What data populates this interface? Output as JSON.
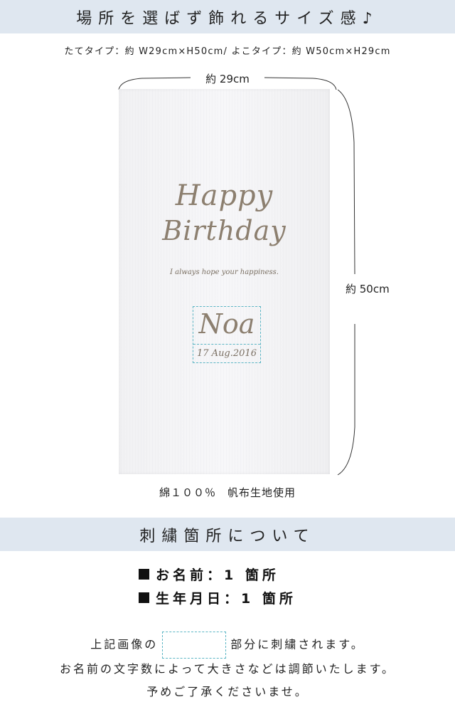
{
  "section1": {
    "title": "場所を選ばず飾れるサイズ感♪"
  },
  "sizes_line": "たてタイプ：約 W29cm×H50cm/ よこタイプ：約 W50cm×H29cm",
  "dimensions": {
    "width_label": "約 29cm",
    "height_label": "約 50cm"
  },
  "banner": {
    "line1": "Happy",
    "line2": "Birthday",
    "motto": "I always hope your happiness.",
    "name": "Noa",
    "date": "17 Aug.2016"
  },
  "material": "綿１００％　帆布生地使用",
  "section2": {
    "title": "刺繍箇所について"
  },
  "embroidery_items": [
    "お名前：1 箇所",
    "生年月日：1 箇所"
  ],
  "notes": {
    "line1_before": "上記画像の",
    "line1_after": "部分に刺繍されます。",
    "line2": "お名前の文字数によって大きさなどは調節いたします。",
    "line3": "予めご了承くださいませ。"
  },
  "colors": {
    "band": "#dfe7f0",
    "embroidery": "#8c7f6f",
    "dashed_box": "#5bb5c4"
  }
}
